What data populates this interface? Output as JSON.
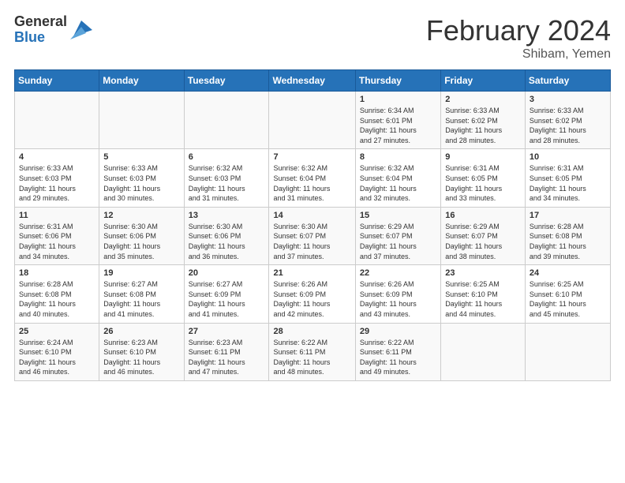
{
  "header": {
    "logo_general": "General",
    "logo_blue": "Blue",
    "month_title": "February 2024",
    "location": "Shibam, Yemen"
  },
  "weekdays": [
    "Sunday",
    "Monday",
    "Tuesday",
    "Wednesday",
    "Thursday",
    "Friday",
    "Saturday"
  ],
  "weeks": [
    [
      {
        "day": "",
        "info": ""
      },
      {
        "day": "",
        "info": ""
      },
      {
        "day": "",
        "info": ""
      },
      {
        "day": "",
        "info": ""
      },
      {
        "day": "1",
        "info": "Sunrise: 6:34 AM\nSunset: 6:01 PM\nDaylight: 11 hours\nand 27 minutes."
      },
      {
        "day": "2",
        "info": "Sunrise: 6:33 AM\nSunset: 6:02 PM\nDaylight: 11 hours\nand 28 minutes."
      },
      {
        "day": "3",
        "info": "Sunrise: 6:33 AM\nSunset: 6:02 PM\nDaylight: 11 hours\nand 28 minutes."
      }
    ],
    [
      {
        "day": "4",
        "info": "Sunrise: 6:33 AM\nSunset: 6:03 PM\nDaylight: 11 hours\nand 29 minutes."
      },
      {
        "day": "5",
        "info": "Sunrise: 6:33 AM\nSunset: 6:03 PM\nDaylight: 11 hours\nand 30 minutes."
      },
      {
        "day": "6",
        "info": "Sunrise: 6:32 AM\nSunset: 6:03 PM\nDaylight: 11 hours\nand 31 minutes."
      },
      {
        "day": "7",
        "info": "Sunrise: 6:32 AM\nSunset: 6:04 PM\nDaylight: 11 hours\nand 31 minutes."
      },
      {
        "day": "8",
        "info": "Sunrise: 6:32 AM\nSunset: 6:04 PM\nDaylight: 11 hours\nand 32 minutes."
      },
      {
        "day": "9",
        "info": "Sunrise: 6:31 AM\nSunset: 6:05 PM\nDaylight: 11 hours\nand 33 minutes."
      },
      {
        "day": "10",
        "info": "Sunrise: 6:31 AM\nSunset: 6:05 PM\nDaylight: 11 hours\nand 34 minutes."
      }
    ],
    [
      {
        "day": "11",
        "info": "Sunrise: 6:31 AM\nSunset: 6:06 PM\nDaylight: 11 hours\nand 34 minutes."
      },
      {
        "day": "12",
        "info": "Sunrise: 6:30 AM\nSunset: 6:06 PM\nDaylight: 11 hours\nand 35 minutes."
      },
      {
        "day": "13",
        "info": "Sunrise: 6:30 AM\nSunset: 6:06 PM\nDaylight: 11 hours\nand 36 minutes."
      },
      {
        "day": "14",
        "info": "Sunrise: 6:30 AM\nSunset: 6:07 PM\nDaylight: 11 hours\nand 37 minutes."
      },
      {
        "day": "15",
        "info": "Sunrise: 6:29 AM\nSunset: 6:07 PM\nDaylight: 11 hours\nand 37 minutes."
      },
      {
        "day": "16",
        "info": "Sunrise: 6:29 AM\nSunset: 6:07 PM\nDaylight: 11 hours\nand 38 minutes."
      },
      {
        "day": "17",
        "info": "Sunrise: 6:28 AM\nSunset: 6:08 PM\nDaylight: 11 hours\nand 39 minutes."
      }
    ],
    [
      {
        "day": "18",
        "info": "Sunrise: 6:28 AM\nSunset: 6:08 PM\nDaylight: 11 hours\nand 40 minutes."
      },
      {
        "day": "19",
        "info": "Sunrise: 6:27 AM\nSunset: 6:08 PM\nDaylight: 11 hours\nand 41 minutes."
      },
      {
        "day": "20",
        "info": "Sunrise: 6:27 AM\nSunset: 6:09 PM\nDaylight: 11 hours\nand 41 minutes."
      },
      {
        "day": "21",
        "info": "Sunrise: 6:26 AM\nSunset: 6:09 PM\nDaylight: 11 hours\nand 42 minutes."
      },
      {
        "day": "22",
        "info": "Sunrise: 6:26 AM\nSunset: 6:09 PM\nDaylight: 11 hours\nand 43 minutes."
      },
      {
        "day": "23",
        "info": "Sunrise: 6:25 AM\nSunset: 6:10 PM\nDaylight: 11 hours\nand 44 minutes."
      },
      {
        "day": "24",
        "info": "Sunrise: 6:25 AM\nSunset: 6:10 PM\nDaylight: 11 hours\nand 45 minutes."
      }
    ],
    [
      {
        "day": "25",
        "info": "Sunrise: 6:24 AM\nSunset: 6:10 PM\nDaylight: 11 hours\nand 46 minutes."
      },
      {
        "day": "26",
        "info": "Sunrise: 6:23 AM\nSunset: 6:10 PM\nDaylight: 11 hours\nand 46 minutes."
      },
      {
        "day": "27",
        "info": "Sunrise: 6:23 AM\nSunset: 6:11 PM\nDaylight: 11 hours\nand 47 minutes."
      },
      {
        "day": "28",
        "info": "Sunrise: 6:22 AM\nSunset: 6:11 PM\nDaylight: 11 hours\nand 48 minutes."
      },
      {
        "day": "29",
        "info": "Sunrise: 6:22 AM\nSunset: 6:11 PM\nDaylight: 11 hours\nand 49 minutes."
      },
      {
        "day": "",
        "info": ""
      },
      {
        "day": "",
        "info": ""
      }
    ]
  ]
}
